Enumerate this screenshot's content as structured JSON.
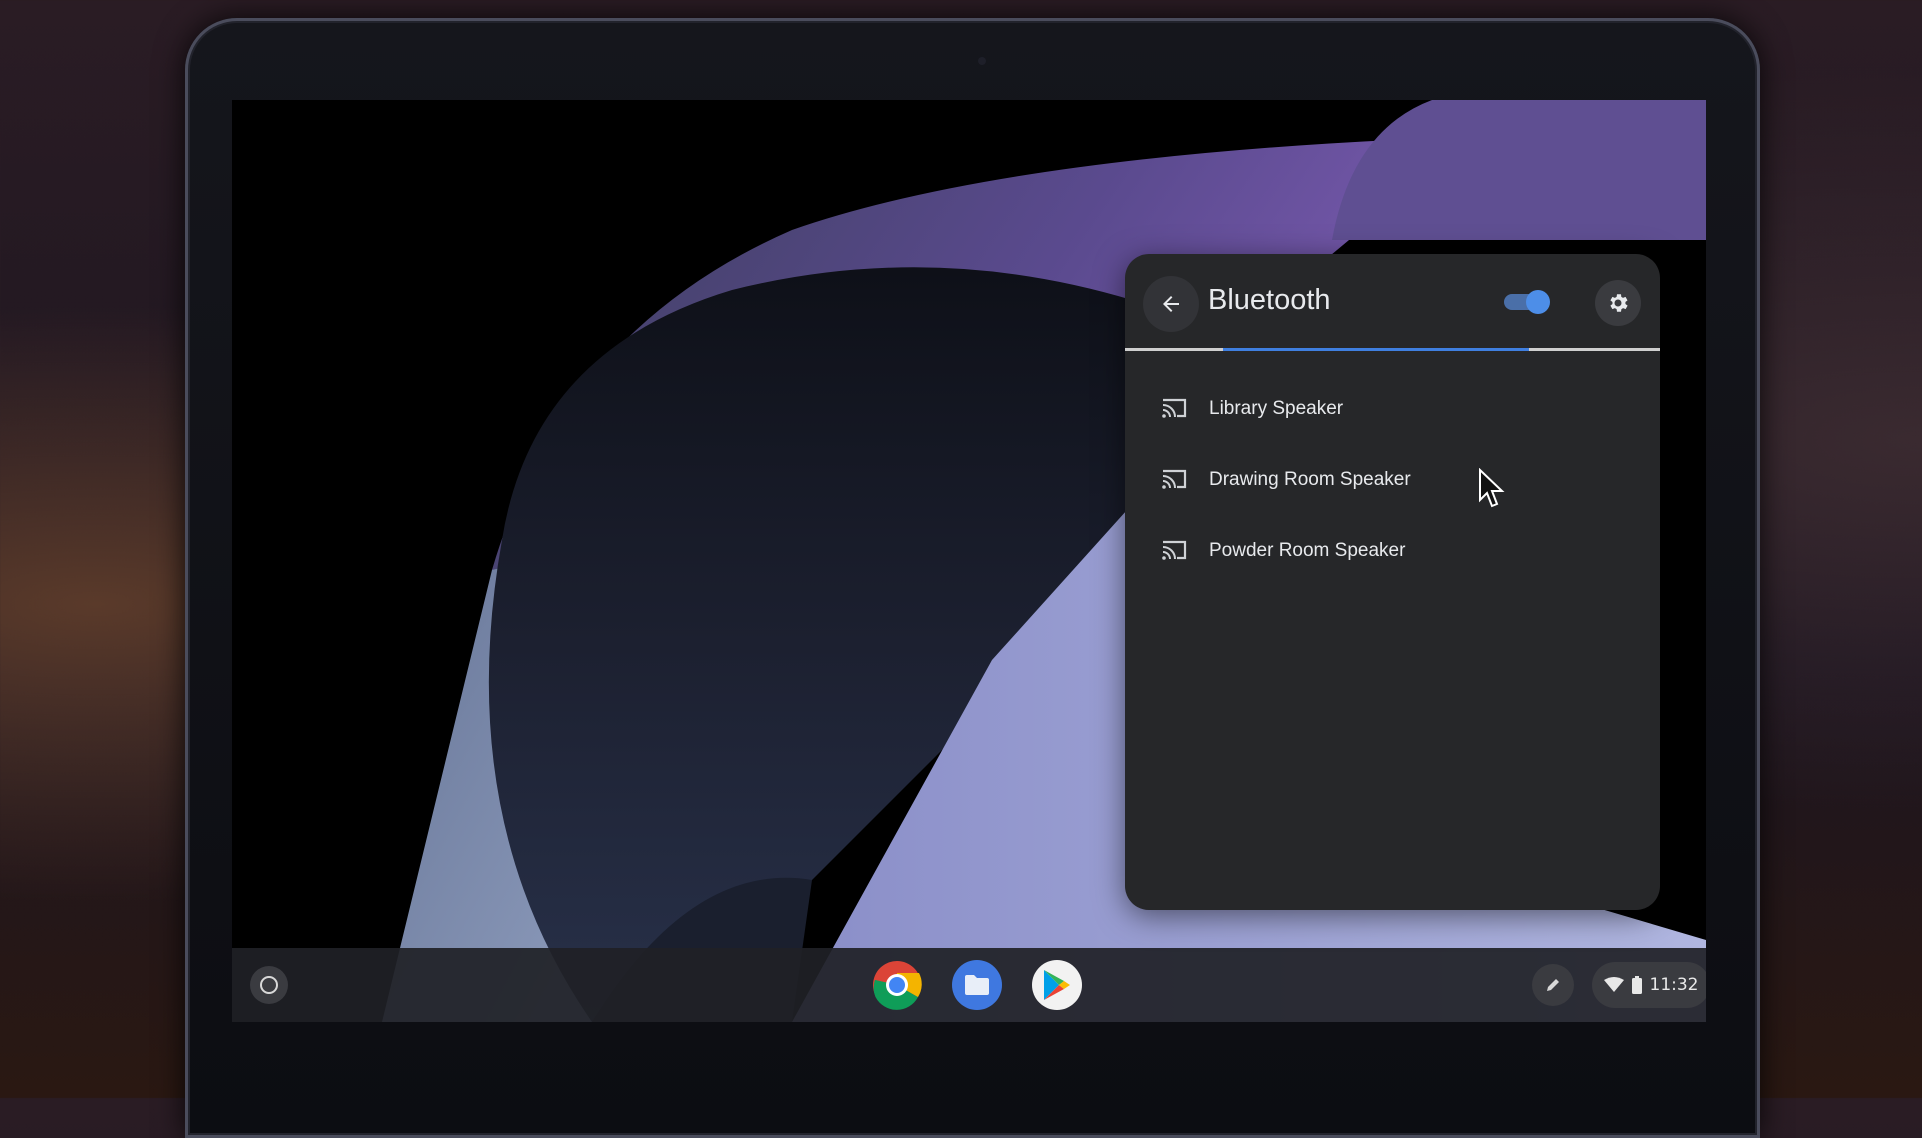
{
  "bluetooth_panel": {
    "title": "Bluetooth",
    "toggle_state": "on",
    "accent_color": "#4d8ee8",
    "devices": [
      {
        "label": "Library Speaker",
        "icon": "cast-icon"
      },
      {
        "label": "Drawing Room Speaker",
        "icon": "cast-icon"
      },
      {
        "label": "Powder Room Speaker",
        "icon": "cast-icon"
      }
    ]
  },
  "shelf": {
    "apps": [
      {
        "name": "chrome-icon"
      },
      {
        "name": "files-icon"
      },
      {
        "name": "play-store-icon"
      }
    ],
    "clock": "11:32"
  }
}
